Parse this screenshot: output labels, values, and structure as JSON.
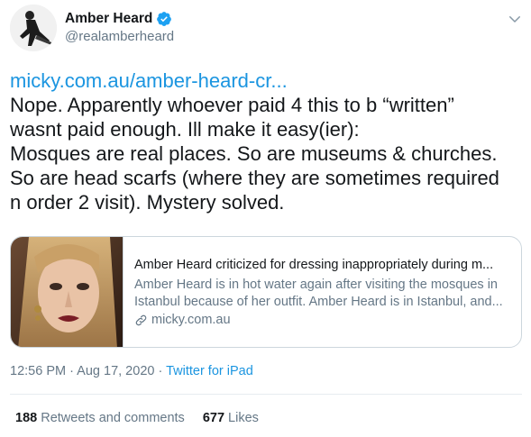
{
  "author": {
    "display_name": "Amber Heard",
    "handle": "@realamberheard",
    "verified": true
  },
  "tweet": {
    "link_text": "micky.com.au/amber-heard-cr...",
    "lines": [
      "Nope. Apparently whoever paid 4 this to b “written”",
      "wasnt paid enough.  Ill make it easy(ier):",
      "Mosques are real places. So are museums & churches.",
      "So are head scarfs (where they are sometimes required",
      "n order 2 visit). Mystery solved."
    ]
  },
  "card": {
    "title": "Amber Heard criticized for dressing inappropriately during m...",
    "description_lines": [
      "Amber Heard is in hot water again after visiting the mosques in",
      "Istanbul because of her outfit. Amber Heard is in Istanbul, and..."
    ],
    "domain": "micky.com.au",
    "domain_icon": "link-icon"
  },
  "meta": {
    "time": "12:56 PM",
    "separator1": " · ",
    "date": "Aug 17, 2020",
    "separator2": " · ",
    "source": "Twitter for iPad"
  },
  "stats": {
    "retweets_count": "188",
    "retweets_label": "Retweets and comments",
    "likes_count": "677",
    "likes_label": "Likes"
  },
  "colors": {
    "link": "#1b95e0",
    "secondary_text": "#657786",
    "primary_text": "#14171a",
    "border": "#ccd6dd"
  }
}
